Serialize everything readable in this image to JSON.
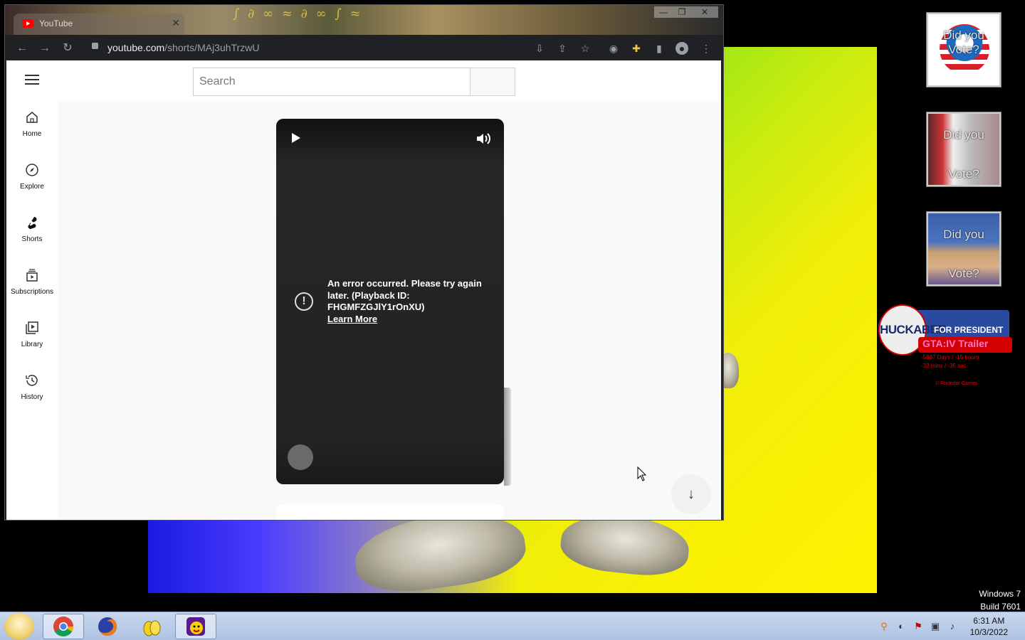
{
  "browser": {
    "tab_title": "YouTube",
    "tab_close": "✕",
    "url_host": "youtube.com",
    "url_path": "/shorts/MAj3uhTrzwU",
    "window_controls": {
      "minimize": "—",
      "maximize": "❐",
      "close": "✕"
    }
  },
  "youtube": {
    "search_placeholder": "Search",
    "guide": [
      {
        "label": "Home",
        "icon": "home-icon"
      },
      {
        "label": "Explore",
        "icon": "compass-icon"
      },
      {
        "label": "Shorts",
        "icon": "shorts-icon"
      },
      {
        "label": "Subscriptions",
        "icon": "subscriptions-icon"
      },
      {
        "label": "Library",
        "icon": "library-icon"
      },
      {
        "label": "History",
        "icon": "history-icon"
      }
    ],
    "player": {
      "error_message": "An error occurred. Please try again later. (Playback ID: FHGMFZGJlY1rOnXU)",
      "learn_more": "Learn More"
    }
  },
  "gadgets": {
    "obama_label": "Did you Vote?",
    "mccain_top": "Did you",
    "mccain_bottom": "Vote?",
    "clinton_top": "Did you",
    "clinton_bottom": "Vote?",
    "huckabee_name": "HUCKABEE",
    "huckabee_tagline": "FOR PRESIDENT",
    "gta_title": "GTA:IV Trailer",
    "gta_count_line1": "-5887 Days / -15 hours",
    "gta_count_line2": "-32 mins / -35 sec",
    "gta_credit": "© Rockstar Games"
  },
  "system": {
    "os_name": "Windows 7",
    "os_build": "Build 7601",
    "time": "6:31 AM",
    "date": "10/3/2022"
  },
  "colors": {
    "youtube_red": "#ff0000",
    "chrome_dark": "#202124",
    "taskbar": "#b9cce8"
  }
}
